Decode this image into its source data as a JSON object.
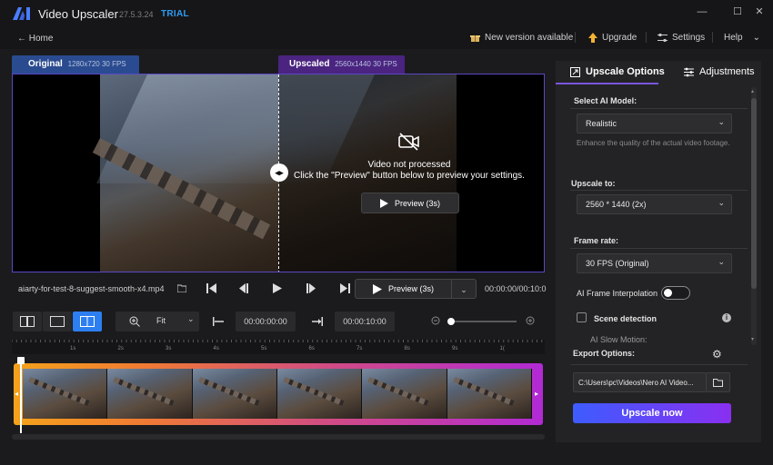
{
  "app": {
    "title": "Video Upscaler",
    "version": "27.5.3.24",
    "badge": "TRIAL",
    "window_controls": {
      "minimize": "—",
      "maximize": "☐",
      "close": "✕"
    }
  },
  "nav": {
    "home": "← Home",
    "new_version": "New version available",
    "upgrade": "Upgrade",
    "settings": "Settings",
    "help": "Help"
  },
  "preview": {
    "original_tab": "Original",
    "original_info": "1280x720 30 FPS",
    "upscaled_tab": "Upscaled",
    "upscaled_info": "2560x1440 30 FPS",
    "not_processed_title": "Video not processed",
    "not_processed_sub": "Click the \"Preview\" button below to preview your settings.",
    "inline_preview_label": "Preview (3s)",
    "split_handle": "◂▸"
  },
  "player": {
    "filename": "aiarty-for-test-8-suggest-smooth-x4.mp4",
    "preview_label": "Preview (3s)",
    "timecode": "00:00:00/00:10:0"
  },
  "timeline_tools": {
    "zoom_label": "Fit",
    "start_time": "00:00:00:00",
    "end_time": "00:00:10:00",
    "zoom_level": 0.05,
    "ruler_labels": [
      "1s",
      "2s",
      "3s",
      "4s",
      "5s",
      "6s",
      "7s",
      "8s",
      "9s",
      "1("
    ]
  },
  "right_panel": {
    "tab_upscale": "Upscale Options",
    "tab_adjust": "Adjustments",
    "ai_model_label": "Select AI Model:",
    "ai_model_value": "Realistic",
    "ai_model_desc": "Enhance the quality of the actual video footage.",
    "upscale_to_label": "Upscale to:",
    "upscale_to_value": "2560 * 1440 (2x)",
    "frame_rate_label": "Frame rate:",
    "frame_rate_value": "30 FPS (Original)",
    "interp_label": "AI Frame Interpolation",
    "scene_label": "Scene detection",
    "slow_motion_label": "AI Slow Motion:",
    "export_label": "Export Options:",
    "export_path": "C:\\Users\\pc\\Videos\\Nero AI Video...",
    "upscale_button": "Upscale now",
    "interp_enabled": false,
    "scene_enabled": false
  },
  "colors": {
    "accent_blue": "#2d7ff0",
    "accent_purple": "#7a55e0",
    "trial": "#2e9bf0",
    "track_start": "#f4a21b",
    "track_end": "#b12ad4"
  }
}
